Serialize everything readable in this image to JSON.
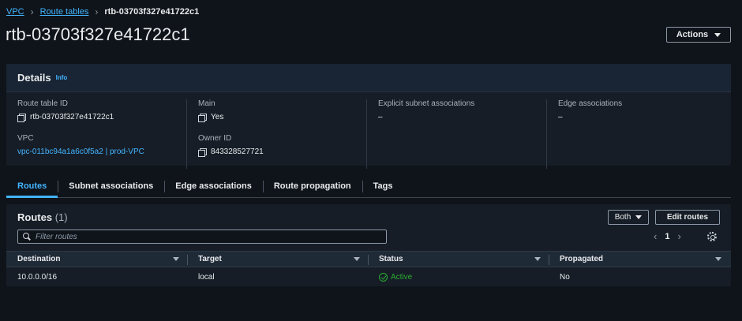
{
  "breadcrumb": {
    "items": [
      "VPC",
      "Route tables"
    ],
    "current": "rtb-03703f327e41722c1"
  },
  "page_title": "rtb-03703f327e41722c1",
  "actions_label": "Actions",
  "details": {
    "header": "Details",
    "info": "Info",
    "route_table_id_label": "Route table ID",
    "route_table_id": "rtb-03703f327e41722c1",
    "vpc_label": "VPC",
    "vpc": "vpc-011bc94a1a6c0f5a2 | prod-VPC",
    "main_label": "Main",
    "main": "Yes",
    "owner_id_label": "Owner ID",
    "owner_id": "843328527721",
    "explicit_label": "Explicit subnet associations",
    "explicit": "–",
    "edge_label": "Edge associations",
    "edge": "–"
  },
  "tabs": [
    {
      "label": "Routes",
      "active": true
    },
    {
      "label": "Subnet associations"
    },
    {
      "label": "Edge associations"
    },
    {
      "label": "Route propagation"
    },
    {
      "label": "Tags"
    }
  ],
  "routes": {
    "title": "Routes",
    "count": "(1)",
    "filter_select": "Both",
    "edit_label": "Edit routes",
    "filter_placeholder": "Filter routes",
    "page": "1",
    "columns": [
      "Destination",
      "Target",
      "Status",
      "Propagated"
    ],
    "rows": [
      {
        "destination": "10.0.0.0/16",
        "target": "local",
        "status": "Active",
        "propagated": "No"
      }
    ]
  },
  "colors": {
    "accent": "#42b4ff",
    "status_active": "#29ad32",
    "background": "#0f141a",
    "panel": "#161d26"
  }
}
